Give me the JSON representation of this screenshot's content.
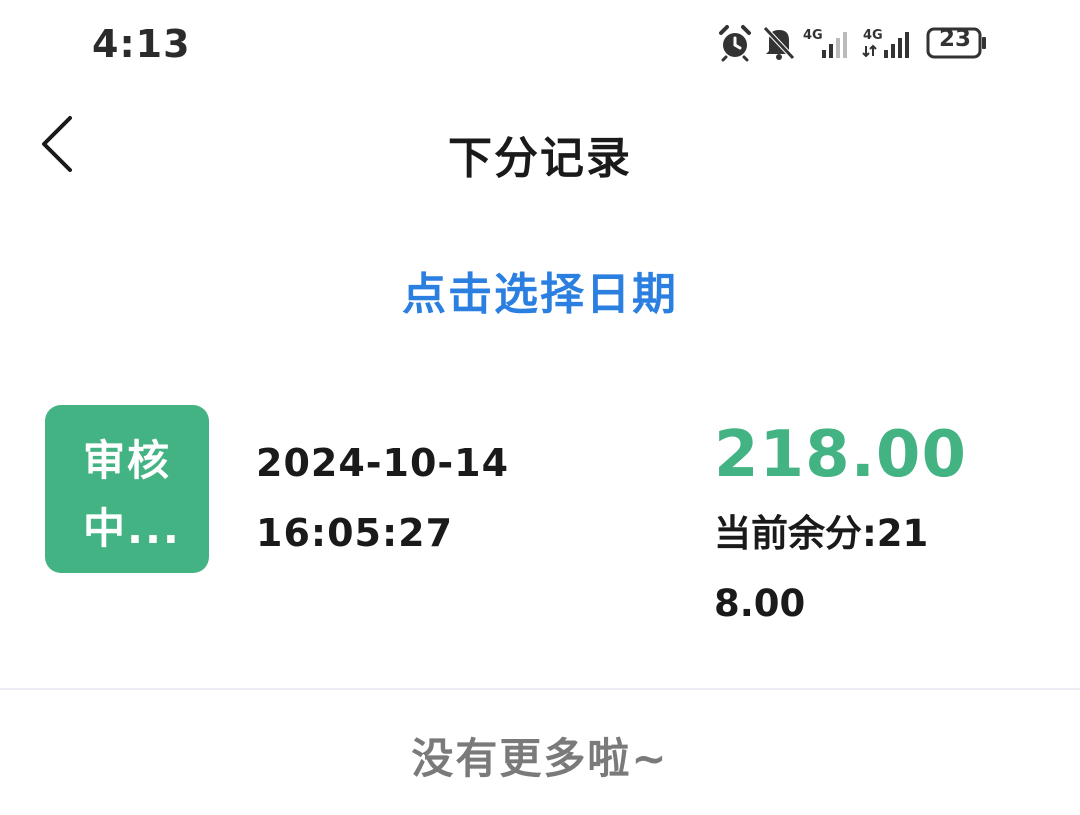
{
  "status_bar": {
    "time": "4:13",
    "battery_level": "23",
    "network_1": "4G",
    "network_2": "4G",
    "icons": [
      "alarm-icon",
      "bell-off-icon",
      "signal-icon",
      "signal-icon",
      "battery-icon"
    ]
  },
  "header": {
    "title": "下分记录",
    "back_icon": "chevron-left-icon"
  },
  "date_filter": {
    "label": "点击选择日期"
  },
  "records": [
    {
      "status": "审核中...",
      "date": "2024-10-14",
      "time": "16:05:27",
      "amount": "218.00",
      "balance_text": "当前余分:218.00"
    }
  ],
  "footer": {
    "no_more_text": "没有更多啦~"
  },
  "colors": {
    "accent_blue": "#2a7fe0",
    "status_green": "#43b383",
    "text_dark": "#1a1a1a",
    "text_gray": "#7a7a7a",
    "divider": "#ececf4"
  }
}
